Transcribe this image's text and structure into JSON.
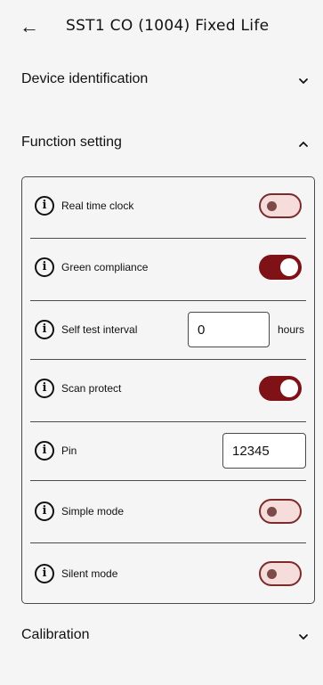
{
  "header": {
    "title": "SST1 CO (1004) Fixed Life"
  },
  "sections": {
    "device_identification": {
      "label": "Device identification"
    },
    "function_setting": {
      "label": "Function setting"
    },
    "calibration": {
      "label": "Calibration"
    }
  },
  "rows": [
    {
      "label": "Real time clock",
      "type": "toggle",
      "on": false
    },
    {
      "label": "Green compliance",
      "type": "toggle",
      "on": true
    },
    {
      "label": "Self test interval",
      "type": "input",
      "value": "0",
      "unit": "hours"
    },
    {
      "label": "Scan protect",
      "type": "toggle",
      "on": true
    },
    {
      "label": "Pin",
      "type": "input",
      "value": "12345"
    },
    {
      "label": "Simple mode",
      "type": "toggle",
      "on": false
    },
    {
      "label": "Silent mode",
      "type": "toggle",
      "on": false
    }
  ],
  "colors": {
    "toggle_on": "#7e1216",
    "toggle_off": "#f6dcda",
    "background": "#f5f5f5"
  },
  "icons": {
    "back": "arrow-left-icon",
    "info": "info-icon",
    "expand": "chevron-down-icon",
    "collapse": "chevron-up-icon"
  }
}
